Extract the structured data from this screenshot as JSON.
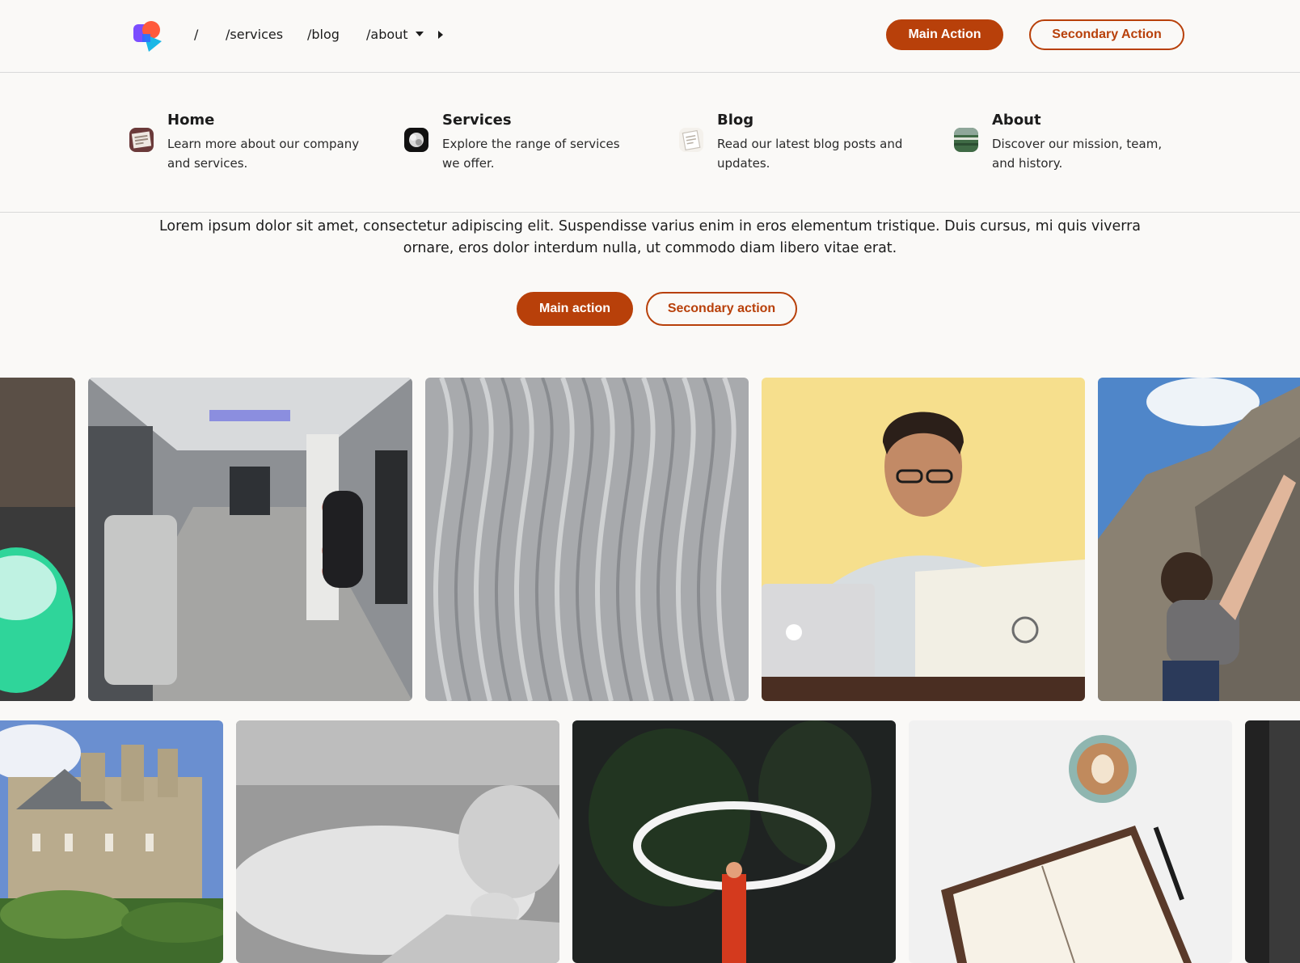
{
  "header": {
    "logo": "brand-logo",
    "nav": [
      {
        "label": "/"
      },
      {
        "label": "/services"
      },
      {
        "label": "/blog"
      },
      {
        "label": "/about"
      }
    ],
    "main_action": "Main Action",
    "secondary_action": "Secondary Action"
  },
  "mega_menu": [
    {
      "title": "Home",
      "description": "Learn more about our company and services.",
      "icon": "newspaper-thumbnail"
    },
    {
      "title": "Services",
      "description": "Explore the range of services we offer.",
      "icon": "flower-thumbnail"
    },
    {
      "title": "Blog",
      "description": "Read our latest blog posts and updates.",
      "icon": "notepad-thumbnail"
    },
    {
      "title": "About",
      "description": "Discover our mission, team, and history.",
      "icon": "landscape-thumbnail"
    }
  ],
  "hero": {
    "text": "Lorem ipsum dolor sit amet, consectetur adipiscing elit. Suspendisse varius enim in eros elementum tristique. Duis cursus, mi quis viverra ornare, eros dolor interdum nulla, ut commodo diam libero vitae erat.",
    "main_action": "Main action",
    "secondary_action": "Secondary action"
  },
  "gallery": {
    "row1": [
      "partial-green-image",
      "train-interior-photo",
      "wavy-metal-texture-photo",
      "man-with-laptops-photo",
      "rock-climber-photo"
    ],
    "row2": [
      "castle-photo",
      "sleeping-baby-photo",
      "fire-spinner-photo",
      "coffee-and-bible-photo",
      "partial-dark-image"
    ]
  },
  "colors": {
    "accent": "#b8400a",
    "background": "#faf9f7",
    "border": "#d9d9d9"
  }
}
